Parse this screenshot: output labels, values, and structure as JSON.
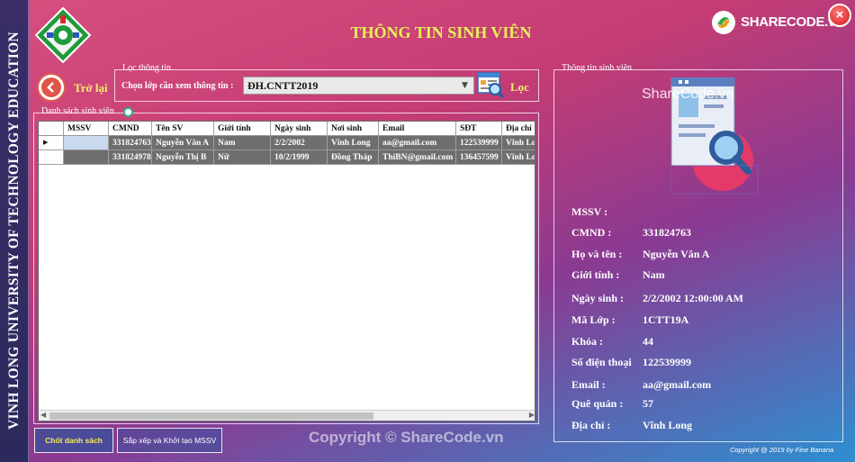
{
  "sidebar": {
    "text": "VINH LONG UNIVERSITY OF TECHNOLOGY EDUCATION"
  },
  "header": {
    "title": "THÔNG TIN SINH VIÊN",
    "brand": "SHARECODE.vn",
    "close_label": "×"
  },
  "back": {
    "label": "Trở lại"
  },
  "filter": {
    "legend": "Lọc thông tin",
    "label": "Chọn lớp cần xem thông tin :",
    "selected": "ĐH.CNTT2019",
    "button_label": "Lọc"
  },
  "list": {
    "legend": "Danh sách sinh viên",
    "columns": [
      "MSSV",
      "CMND",
      "Tên SV",
      "Giới tính",
      "Ngày sinh",
      "Nơi sinh",
      "Email",
      "SĐT",
      "Địa chỉ"
    ],
    "rows": [
      {
        "mssv": "",
        "cmnd": "331824763",
        "ten": "Nguyễn Văn A",
        "gioitinh": "Nam",
        "ngaysinh": "2/2/2002",
        "noisinh": "Vĩnh Long",
        "email": "aa@gmail.com",
        "sdt": "122539999",
        "diachi": "Vĩnh Long"
      },
      {
        "mssv": "",
        "cmnd": "331824978",
        "ten": "Nguyễn Thị B",
        "gioitinh": "Nữ",
        "ngaysinh": "10/2/1999",
        "noisinh": "Đồng Tháp",
        "email": "ThiBN@gmail.com",
        "sdt": "136457599",
        "diachi": "Vĩnh Long"
      }
    ]
  },
  "actions": {
    "list_button": "Chốt danh sách",
    "sort_button": "Sắp xếp và Khởi tạo MSSV"
  },
  "info": {
    "legend": "Thông tin sinh viên",
    "fields": [
      {
        "label": "MSSV :",
        "value": ""
      },
      {
        "label": "CMND :",
        "value": "331824763"
      },
      {
        "label": "Họ và tên :",
        "value": "Nguyễn Văn A"
      },
      {
        "label": "Giới tính :",
        "value": "Nam"
      },
      {
        "label": "Ngày sinh :",
        "value": "2/2/2002 12:00:00 AM"
      },
      {
        "label": "Mã Lớp :",
        "value": "1CTT19A"
      },
      {
        "label": "Khóa :",
        "value": "44"
      },
      {
        "label": "Số điện thoại",
        "value": "122539999"
      },
      {
        "label": "Email :",
        "value": "aa@gmail.com"
      },
      {
        "label": "Quê quán :",
        "value": "57"
      },
      {
        "label": "Địa chỉ :",
        "value": "Vĩnh Long"
      }
    ]
  },
  "watermarks": {
    "top": "ShareCode.vn",
    "bottom": "Copyright © ShareCode.vn"
  },
  "footer": {
    "copyright": "Copyright @ 2019 by Fine Banana"
  },
  "colors": {
    "accent_yellow": "#e9ef5b",
    "row_dark": "#6e6e6e",
    "selected_cell": "#c9d9ee"
  },
  "icons": [
    "university-logo",
    "sharecode-logo",
    "close-icon",
    "back-arrow-icon",
    "filter-icon",
    "refresh-icon",
    "student-info-icon"
  ]
}
